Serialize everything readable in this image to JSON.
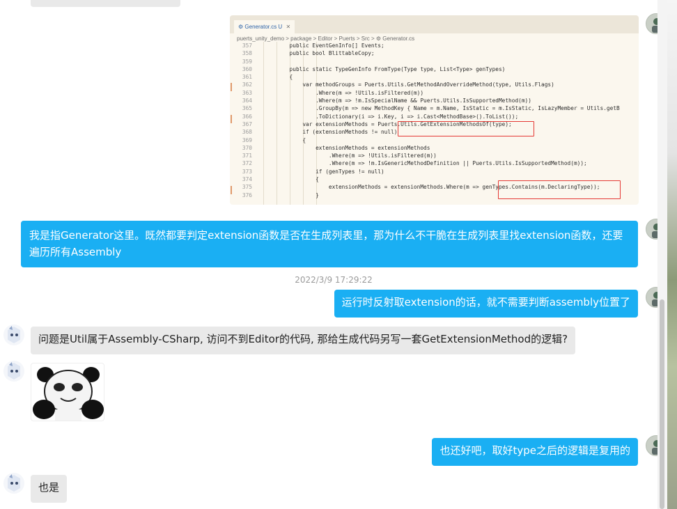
{
  "code_screenshot": {
    "tab_label": "Generator.cs U",
    "breadcrumb": "puerts_unity_demo > package > Editor > Puerts > Src > ⚙ Generator.cs",
    "lines": [
      {
        "num": "357",
        "code": "        public EventGenInfo[] Events;"
      },
      {
        "num": "358",
        "code": "        public bool BlittableCopy;"
      },
      {
        "num": "359",
        "code": ""
      },
      {
        "num": "360",
        "code": "        public static TypeGenInfo FromType(Type type, List<Type> genTypes)"
      },
      {
        "num": "361",
        "code": "        {"
      },
      {
        "num": "362",
        "code": "            var methodGroups = Puerts.Utils.GetMethodAndOverrideMethod(type, Utils.Flags)"
      },
      {
        "num": "363",
        "code": "                .Where(m => !Utils.isFiltered(m))"
      },
      {
        "num": "364",
        "code": "                .Where(m => !m.IsSpecialName && Puerts.Utils.IsSupportedMethod(m))"
      },
      {
        "num": "365",
        "code": "                .GroupBy(m => new MethodKey { Name = m.Name, IsStatic = m.IsStatic, IsLazyMember = Utils.getB"
      },
      {
        "num": "366",
        "code": "                .ToDictionary(i => i.Key, i => i.Cast<MethodBase>().ToList());"
      },
      {
        "num": "367",
        "code": "            var extensionMethods = Puerts.Utils.GetExtensionMethodsOf(type);"
      },
      {
        "num": "368",
        "code": "            if (extensionMethods != null)"
      },
      {
        "num": "369",
        "code": "            {"
      },
      {
        "num": "370",
        "code": "                extensionMethods = extensionMethods"
      },
      {
        "num": "371",
        "code": "                    .Where(m => !Utils.isFiltered(m))"
      },
      {
        "num": "372",
        "code": "                    .Where(m => !m.IsGenericMethodDefinition || Puerts.Utils.IsSupportedMethod(m));"
      },
      {
        "num": "373",
        "code": "                if (genTypes != null)"
      },
      {
        "num": "374",
        "code": "                {"
      },
      {
        "num": "375",
        "code": "                    extensionMethods = extensionMethods.Where(m => genTypes.Contains(m.DeclaringType));"
      },
      {
        "num": "376",
        "code": "                }"
      }
    ]
  },
  "messages": {
    "m1": "我是指Generator这里。既然都要判定extension函数是否在生成列表里，那为什么不干脆在生成列表里找extension函数，还要遍历所有Assembly",
    "timestamp": "2022/3/9 17:29:22",
    "m2": "运行时反射取extension的话，就不需要判断assembly位置了",
    "m3": "问题是Util属于Assembly-CSharp, 访问不到Editor的代码, 那给生成代码另写一套GetExtensionMethod的逻辑?",
    "m4": "也还好吧，取好type之后的逻辑是复用的",
    "m5": "也是"
  },
  "colors": {
    "self_bubble": "#1aaff3",
    "peer_bubble": "#e9e9e9",
    "highlight_box": "#e53935"
  }
}
